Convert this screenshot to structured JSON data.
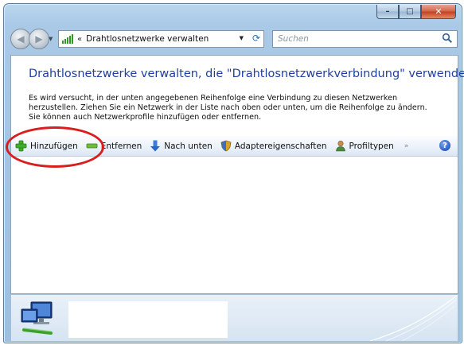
{
  "window": {
    "minimize_glyph": "–",
    "maximize_glyph": "□",
    "close_glyph": "✕"
  },
  "address": {
    "chevron": "«",
    "path": "Drahtlosnetzwerke verwalten"
  },
  "search": {
    "placeholder": "Suchen"
  },
  "main": {
    "heading": "Drahtlosnetzwerke verwalten, die \"Drahtlosnetzwerkverbindung\" verwenden",
    "description": "Es wird versucht, in der unten angegebenen Reihenfolge eine Verbindung zu diesen Netzwerken herzustellen. Ziehen Sie ein Netzwerk in der Liste nach oben oder unten, um die Reihenfolge zu ändern. Sie können auch Netzwerkprofile hinzufügen oder entfernen."
  },
  "toolbar": {
    "add_label": "Hinzufügen",
    "remove_label": "Entfernen",
    "move_down_label": "Nach unten",
    "adapter_props_label": "Adaptereigenschaften",
    "profile_types_label": "Profiltypen",
    "overflow": "»",
    "help": "?"
  },
  "colors": {
    "heading": "#1e3fa0",
    "highlight": "#d81e1e",
    "frame": "#a9c9e6"
  },
  "icons": {
    "add": "plus-icon",
    "remove": "minus-icon",
    "move_down": "arrow-down-icon",
    "adapter": "shield-icon",
    "profile_types": "user-icon",
    "search": "search-icon",
    "network": "network-icon"
  }
}
